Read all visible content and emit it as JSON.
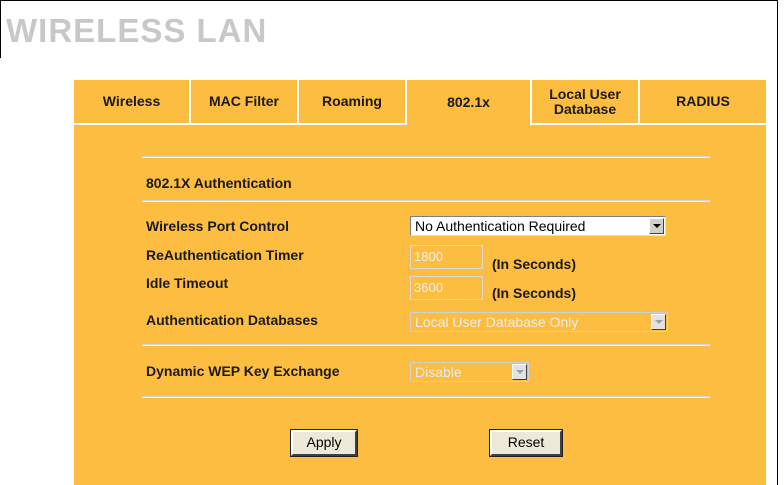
{
  "page": {
    "title": "WIRELESS LAN"
  },
  "tabs": [
    {
      "label": "Wireless",
      "active": false
    },
    {
      "label": "MAC Filter",
      "active": false
    },
    {
      "label": "Roaming",
      "active": false
    },
    {
      "label": "802.1x",
      "active": true
    },
    {
      "label": "Local User\nDatabase",
      "active": false
    },
    {
      "label": "RADIUS",
      "active": false
    }
  ],
  "section": {
    "heading": "802.1X Authentication"
  },
  "fields": {
    "wireless_port_control": {
      "label": "Wireless Port Control",
      "value": "No Authentication Required"
    },
    "reauthentication_timer": {
      "label": "ReAuthentication Timer",
      "value": "1800",
      "unit": "(In Seconds)"
    },
    "idle_timeout": {
      "label": "Idle Timeout",
      "value": "3600",
      "unit": "(In Seconds)"
    },
    "authentication_databases": {
      "label": "Authentication Databases",
      "value": "Local User Database Only"
    },
    "dynamic_wep_key_exchange": {
      "label": "Dynamic WEP Key Exchange",
      "value": "Disable"
    }
  },
  "buttons": {
    "apply": "Apply",
    "reset": "Reset"
  },
  "colors": {
    "panel": "#fcbd40",
    "title": "#c8c8c8"
  }
}
